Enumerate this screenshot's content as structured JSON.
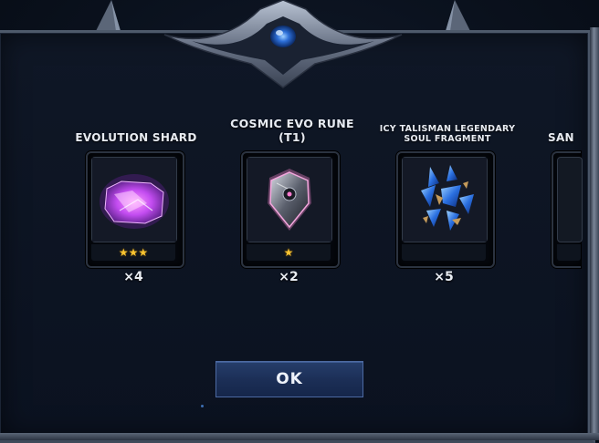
{
  "rewards": [
    {
      "title": "EVOLUTION SHARD",
      "stars": "★★★",
      "quantity": "×4",
      "icon": "evolution-shard-icon"
    },
    {
      "title_line1": "COSMIC EVO RUNE",
      "title_line2": "(T1)",
      "stars": "★",
      "quantity": "×2",
      "icon": "cosmic-evo-rune-icon"
    },
    {
      "title_line1": "ICY TALISMAN LEGENDARY",
      "title_line2": "SOUL FRAGMENT",
      "stars": "",
      "quantity": "×5",
      "icon": "icy-talisman-soul-fragment-icon"
    },
    {
      "title": "SAN",
      "stars": "",
      "quantity": "",
      "icon": "partial-reward-icon"
    }
  ],
  "buttons": {
    "ok_label": "OK"
  },
  "colors": {
    "star": "#f7c331",
    "button": "#1c2f57",
    "frame": "#4e5a6b"
  }
}
